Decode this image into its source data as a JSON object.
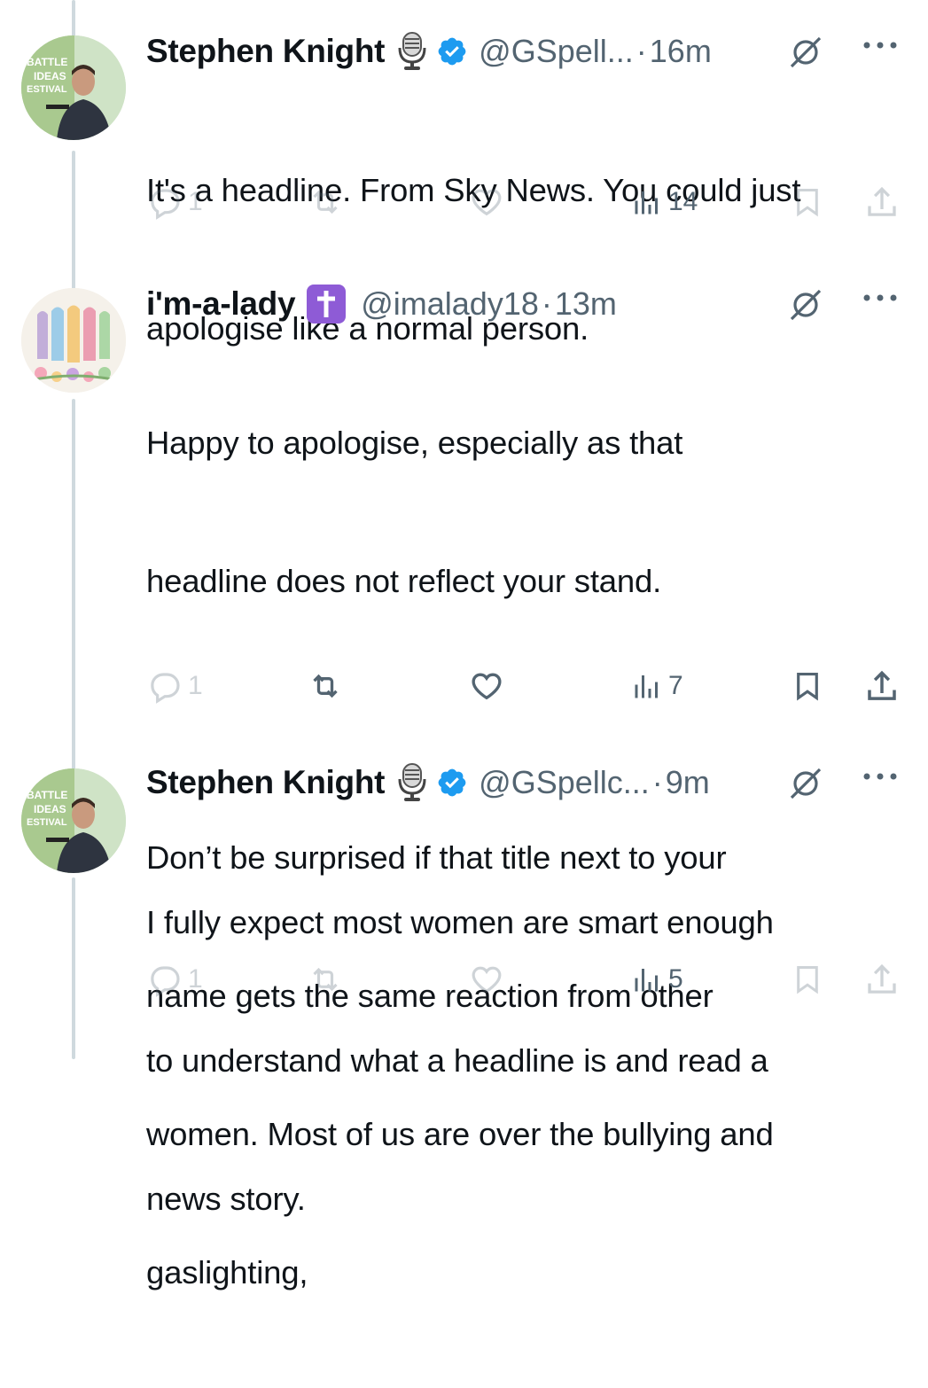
{
  "tweets": [
    {
      "author": "Stephen Knight",
      "author_emoji": "microphone-icon",
      "verified": true,
      "handle": "@GSpell...",
      "time": "16m",
      "separator": "·",
      "text": "It's a headline. From Sky News. You could just apologise like a normal person.",
      "text_lines": [
        "It's a headline. From Sky News. You could just",
        "apologise like a normal person."
      ],
      "avatar_text": [
        "BATTLE",
        "IDEAS",
        "ESTIVAL"
      ],
      "stats": {
        "replies": "1",
        "retweets": "",
        "likes": "",
        "views": "14"
      }
    },
    {
      "author": "i'm-a-lady",
      "author_emoji": "latin-cross-icon",
      "verified": false,
      "handle": "@imalady18",
      "time": "13m",
      "separator": "·",
      "text_lines": [
        "Happy to apologise, especially as that",
        "headline does not reflect your stand.",
        "",
        "Don’t be surprised if that title next to your",
        "name gets the same reaction from other",
        "women. Most of us are over the bullying and",
        "gaslighting,"
      ],
      "stats": {
        "replies": "1",
        "retweets": "",
        "likes": "",
        "views": "7"
      }
    },
    {
      "author": "Stephen Knight",
      "author_emoji": "microphone-icon",
      "verified": true,
      "handle": "@GSpellc...",
      "time": "9m",
      "separator": "·",
      "text_lines": [
        "I fully expect most women are smart enough",
        "to understand what a headline is and read a",
        "news story."
      ],
      "avatar_text": [
        "BATTLE",
        "IDEAS",
        "ESTIVAL"
      ],
      "stats": {
        "replies": "1",
        "retweets": "",
        "likes": "",
        "views": "5"
      }
    }
  ],
  "colors": {
    "text": "#0f1419",
    "secondary": "#536471",
    "verified": "#1d9bf0",
    "thread_line": "#cfd9de",
    "cross_badge": "#8e5bd6"
  }
}
